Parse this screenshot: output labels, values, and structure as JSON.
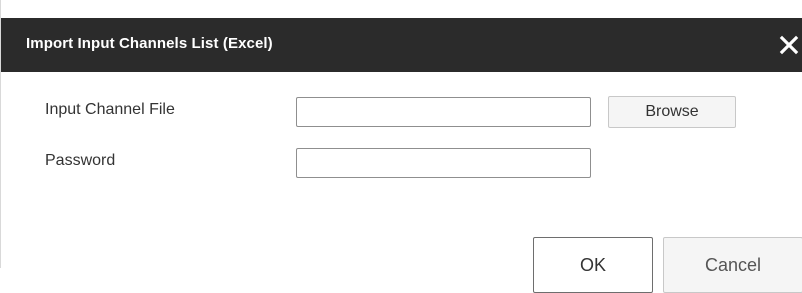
{
  "dialog": {
    "title": "Import Input Channels List (Excel)",
    "close_icon": "close-icon",
    "header_color": "#2b2b2b"
  },
  "form": {
    "input_channel_file": {
      "label": "Input Channel File",
      "value": "",
      "placeholder": ""
    },
    "password": {
      "label": "Password",
      "value": "",
      "placeholder": ""
    },
    "browse_label": "Browse"
  },
  "footer": {
    "ok_label": "OK",
    "cancel_label": "Cancel"
  }
}
